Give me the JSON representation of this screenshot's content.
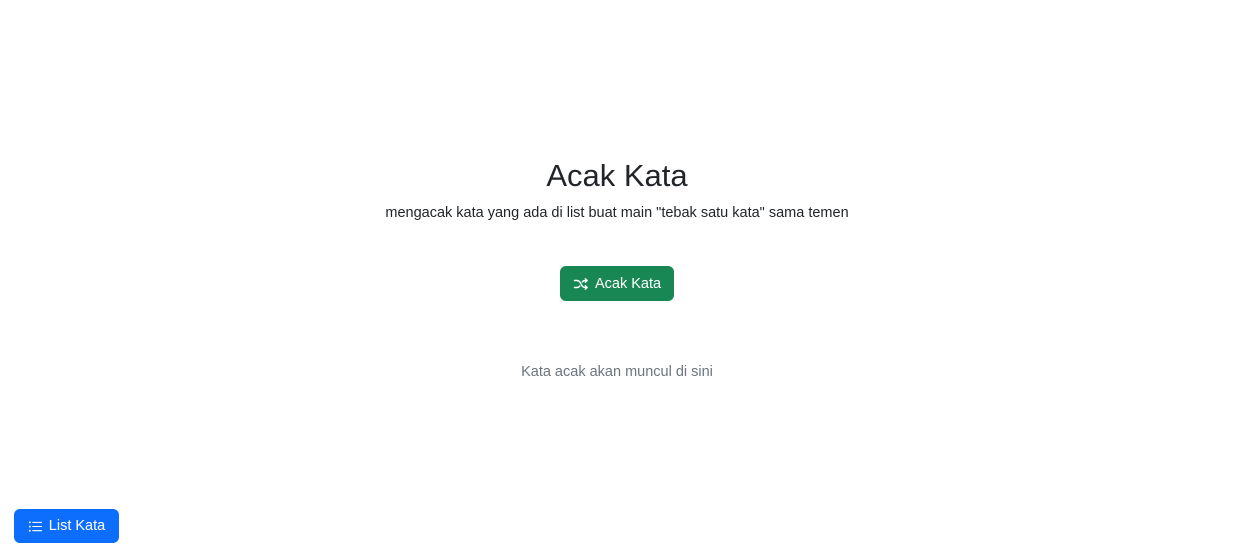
{
  "header": {
    "title": "Acak Kata",
    "subtitle": "mengacak kata yang ada di list buat main \"tebak satu kata\" sama temen"
  },
  "actions": {
    "shuffle_label": "Acak Kata",
    "shuffle_icon": "shuffle-icon",
    "shuffle_color": "#198754"
  },
  "result": {
    "placeholder": "Kata acak akan muncul di sini"
  },
  "footer": {
    "list_label": "List Kata",
    "list_icon": "list-icon",
    "list_color": "#0d6efd"
  }
}
